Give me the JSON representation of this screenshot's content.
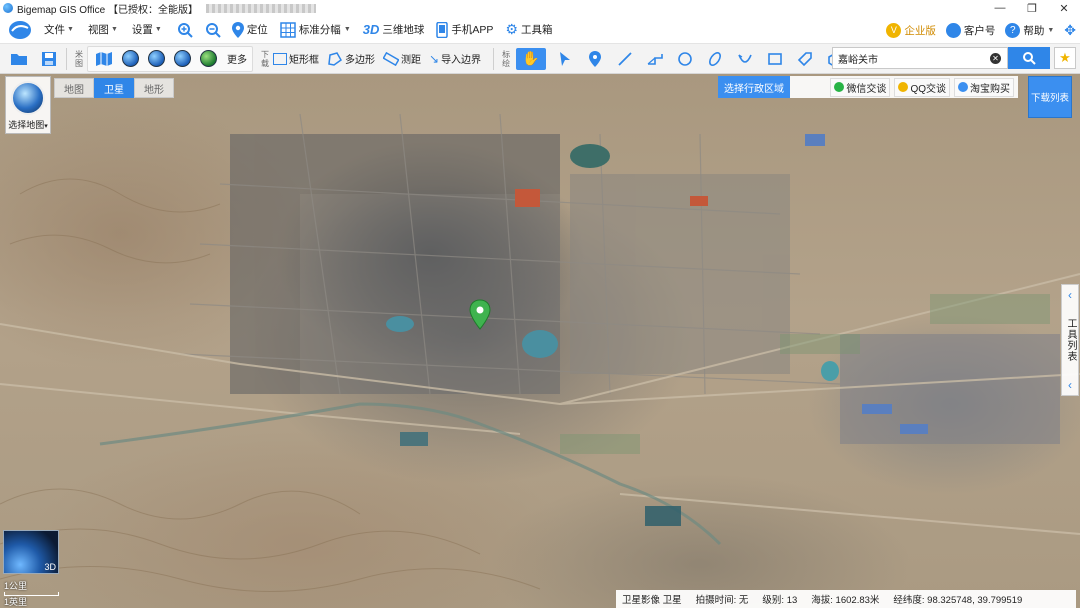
{
  "window": {
    "title": "Bigemap GIS Office 【已授权：全能版】",
    "controls": [
      "—",
      "❐",
      "✕"
    ]
  },
  "menubar": {
    "items": [
      {
        "label": "文件",
        "icon": "caret-down-icon"
      },
      {
        "label": "视图",
        "icon": "caret-down-icon"
      },
      {
        "label": "设置",
        "icon": "caret-down-icon"
      }
    ],
    "zoom_in": "zoom-in-icon",
    "zoom_out": "zoom-out-icon",
    "locate_label": "定位",
    "grid_label": "标准分幅",
    "three_d_badge": "3D",
    "three_d_label": "三维地球",
    "mobile_label": "手机APP",
    "toolbox_label": "工具箱",
    "enterprise_label": "企业版",
    "account_label": "客户号",
    "help_label": "帮助"
  },
  "toolbar": {
    "group_map_label": "米图",
    "more_label": "更多",
    "group_download_label": "下载",
    "rect_label": "矩形框",
    "polygon_label": "多边形",
    "measure_label": "测距",
    "import_label": "导入边界",
    "group_mark_label": "标绘",
    "group_search_label": "搜索",
    "search_value": "嘉峪关市"
  },
  "map": {
    "view_tabs": [
      "地图",
      "卫星",
      "地形"
    ],
    "active_tab": "卫星",
    "select_map_label": "选择地图",
    "region_title": "选择行政区域",
    "region_items": [
      {
        "label": "微信交谈",
        "color": "#28b446"
      },
      {
        "label": "QQ交谈",
        "color": "#f0b400"
      },
      {
        "label": "淘宝购买",
        "color": "#3b8ff0"
      }
    ],
    "download_list_label": "下载列表",
    "side_tab_label": "工具列表",
    "mini_globe_badge": "3D",
    "scale_km": "1公里",
    "scale_mi": "1英里"
  },
  "status": {
    "imagery": "卫星影像 卫星",
    "capture_time": "拍摄时间: 无",
    "level": "级别: 13",
    "altitude": "海拔: 1602.83米",
    "coords": "经纬度: 98.325748, 39.799519"
  },
  "colors": {
    "accent": "#2f86e8",
    "marker": "#3fb34f"
  }
}
